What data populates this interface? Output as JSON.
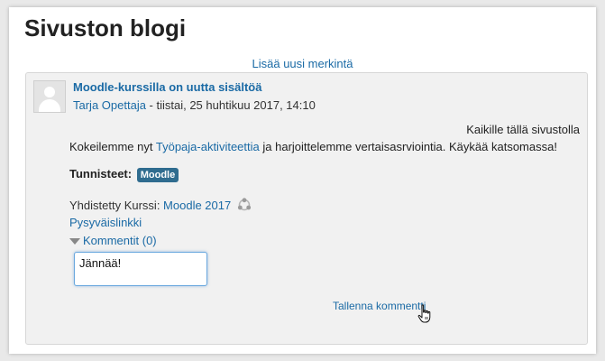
{
  "page": {
    "title": "Sivuston blogi"
  },
  "actions": {
    "add_entry": "Lisää uusi merkintä"
  },
  "post": {
    "title": "Moodle-kurssilla on uutta sisältöä",
    "author": "Tarja Opettaja",
    "date": " - tiistai, 25 huhtikuu 2017, 14:10",
    "body_right": "Kaikille tällä sivustolla",
    "body_before": "Kokeilemme nyt ",
    "body_link": "Työpaja-aktiviteettia",
    "body_after": " ja harjoittelemme vertaisasrviointia. Käykää katsomassa!",
    "tags_label": "Tunnisteet:",
    "tags": [
      "Moodle"
    ],
    "course_label": "Yhdistetty Kurssi: ",
    "course_link": "Moodle 2017",
    "permalink": "Pysyväislinkki",
    "comments_toggle": "Kommentit (0)",
    "comment_value": "Jännää!",
    "save_comment": "Tallenna kommentti"
  },
  "colors": {
    "link": "#1a6aa5",
    "tag_bg": "#2f6c8f",
    "focus": "#6aa8de"
  },
  "icons": {
    "course": "network-icon",
    "cursor": "hand-pointer-icon",
    "toggle": "triangle-down-icon",
    "avatar": "user-avatar-icon"
  }
}
